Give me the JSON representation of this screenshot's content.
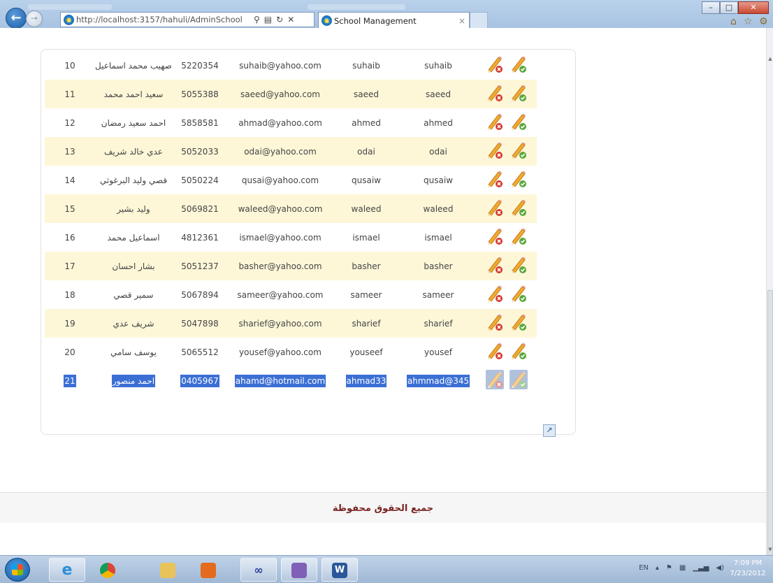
{
  "browser": {
    "address": "http://localhost:3157/hahuli/AdminSchool",
    "tab_title": "School Management",
    "tab_close": "×"
  },
  "rows": [
    {
      "id": "10",
      "name": "صهيب محمد اسماعيل",
      "phone": "5220354",
      "email": "suhaib@yahoo.com",
      "username": "suhaib",
      "password": "suhaib",
      "selected": false,
      "alt": false
    },
    {
      "id": "11",
      "name": "سعيد احمد محمد",
      "phone": "5055388",
      "email": "saeed@yahoo.com",
      "username": "saeed",
      "password": "saeed",
      "selected": false,
      "alt": true
    },
    {
      "id": "12",
      "name": "احمد سعيد رمضان",
      "phone": "5858581",
      "email": "ahmad@yahoo.com",
      "username": "ahmed",
      "password": "ahmed",
      "selected": false,
      "alt": false
    },
    {
      "id": "13",
      "name": "عدي خالد شريف",
      "phone": "5052033",
      "email": "odai@yahoo.com",
      "username": "odai",
      "password": "odai",
      "selected": false,
      "alt": true
    },
    {
      "id": "14",
      "name": "قصي وليد البرغوثي",
      "phone": "5050224",
      "email": "qusai@yahoo.com",
      "username": "qusaiw",
      "password": "qusaiw",
      "selected": false,
      "alt": false
    },
    {
      "id": "15",
      "name": "وليد بشير",
      "phone": "5069821",
      "email": "waleed@yahoo.com",
      "username": "waleed",
      "password": "waleed",
      "selected": false,
      "alt": true
    },
    {
      "id": "16",
      "name": "اسماعيل محمد",
      "phone": "4812361",
      "email": "ismael@yahoo.com",
      "username": "ismael",
      "password": "ismael",
      "selected": false,
      "alt": false
    },
    {
      "id": "17",
      "name": "بشار احسان",
      "phone": "5051237",
      "email": "basher@yahoo.com",
      "username": "basher",
      "password": "basher",
      "selected": false,
      "alt": true
    },
    {
      "id": "18",
      "name": "سمير قصي",
      "phone": "5067894",
      "email": "sameer@yahoo.com",
      "username": "sameer",
      "password": "sameer",
      "selected": false,
      "alt": false
    },
    {
      "id": "19",
      "name": "شريف عدي",
      "phone": "5047898",
      "email": "sharief@yahoo.com",
      "username": "sharief",
      "password": "sharief",
      "selected": false,
      "alt": true
    },
    {
      "id": "20",
      "name": "يوسف سامي",
      "phone": "5065512",
      "email": "yousef@yahoo.com",
      "username": "youseef",
      "password": "yousef",
      "selected": false,
      "alt": false
    },
    {
      "id": "21",
      "name": "احمد منصور",
      "phone": "0405967",
      "email": "ahamd@hotmail.com",
      "username": "ahmad33",
      "password": "ahmmad@345",
      "selected": true,
      "alt": true
    }
  ],
  "actions": {
    "delete_icon": "pencil-delete-icon",
    "edit_icon": "pencil-check-icon"
  },
  "footer": {
    "text": "جميع الحقوق محفوظة"
  },
  "taskbar": {
    "lang": "EN",
    "time": "7:09 PM",
    "date": "7/23/2012"
  },
  "colors": {
    "row_alt": "#fdf7d8",
    "selection": "#3b6fd4",
    "footer_text": "#7a2424"
  }
}
